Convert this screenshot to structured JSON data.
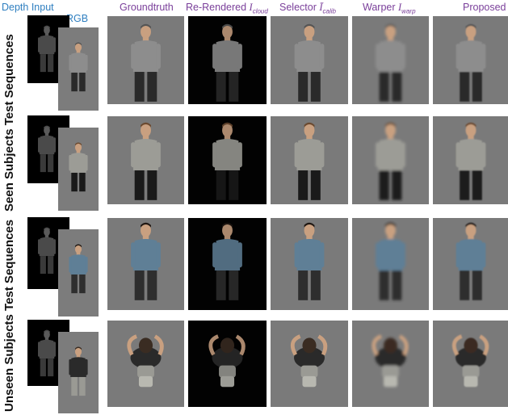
{
  "headers": {
    "depth_input": "Depth Input",
    "rgb": "RGB",
    "groundtruth": "Groundtruth",
    "rerendered": "Re-Rendered",
    "rerendered_symbol": "I",
    "rerendered_sub": "cloud",
    "selector": "Selector",
    "selector_symbol": "Ī",
    "selector_sub": "calib",
    "warper": "Warper",
    "warper_symbol": "I",
    "warper_sub": "warp",
    "proposed": "Proposed"
  },
  "row_labels": {
    "seen_group": "Seen Subjects Test Sequences",
    "unseen_group": "Unseen Subjects Test Sequences"
  },
  "colors": {
    "method_header": "#7a3f9a",
    "input_header": "#2f7fc0",
    "panel_gray": "#7a7a7a",
    "panel_black": "#020202"
  }
}
